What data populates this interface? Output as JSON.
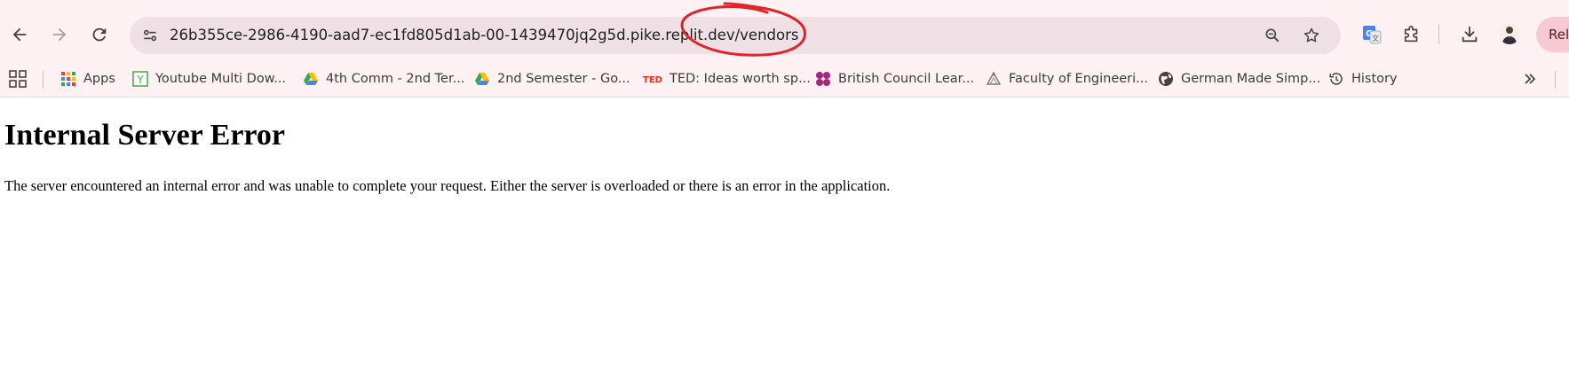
{
  "browser": {
    "address_bar": {
      "url": "26b355ce-2986-4190-aad7-ec1fd805d1ab-00-1439470jq2g5d.pike.replit.dev/vendors"
    },
    "relaunch_label": "Rela",
    "icons": {
      "back": "back-arrow-icon",
      "forward": "forward-arrow-icon",
      "reload": "reload-icon",
      "site_info": "tune-icon",
      "zoom": "zoom-icon",
      "bookmark": "star-icon",
      "translate": "translate-icon",
      "extensions": "puzzle-icon",
      "downloads": "download-icon"
    },
    "accent_color": "#fdf1f3",
    "annotation_color": "#e0242c"
  },
  "bookmarks": {
    "items": [
      {
        "label": "Apps",
        "icon": "apps-grid-icon"
      },
      {
        "label": "Youtube Multi Dow...",
        "icon": "y-box-icon"
      },
      {
        "label": "4th Comm - 2nd Ter...",
        "icon": "google-drive-icon"
      },
      {
        "label": "2nd Semester  - Go...",
        "icon": "google-drive-icon"
      },
      {
        "label": "TED: Ideas worth sp...",
        "icon": "ted-icon"
      },
      {
        "label": "British Council Lear...",
        "icon": "british-council-icon"
      },
      {
        "label": "Faculty of Engineeri...",
        "icon": "faculty-icon"
      },
      {
        "label": "German Made Simp...",
        "icon": "globe-icon"
      },
      {
        "label": "History",
        "icon": "history-icon"
      }
    ]
  },
  "page": {
    "heading": "Internal Server Error",
    "message": "The server encountered an internal error and was unable to complete your request. Either the server is overloaded or there is an error in the application."
  }
}
